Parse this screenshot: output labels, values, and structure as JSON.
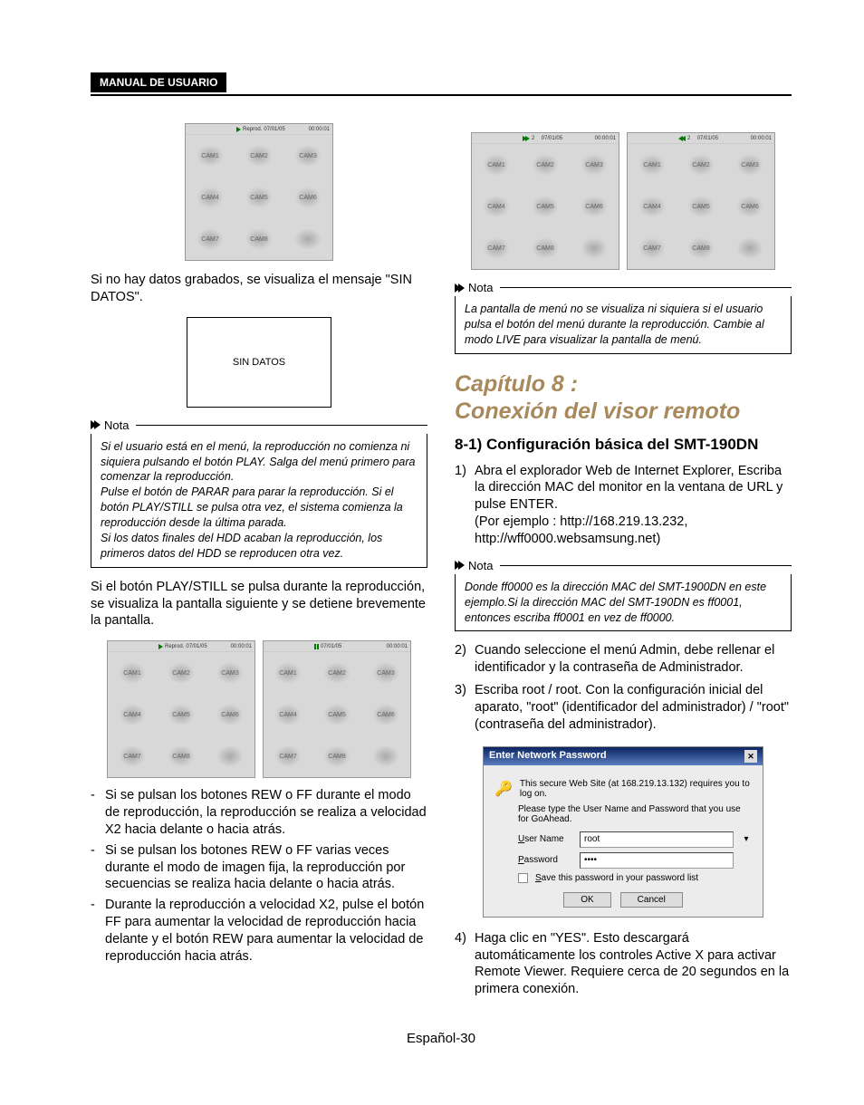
{
  "header": {
    "title": "MANUAL DE USUARIO"
  },
  "cams": [
    "CAM1",
    "CAM2",
    "CAM3",
    "CAM4",
    "CAM5",
    "CAM6",
    "CAM7",
    "CAM8"
  ],
  "grid_bar": {
    "play": {
      "label": "Reprod.",
      "date": "07/01/05",
      "time": "00:00:01"
    },
    "play2": {
      "label": "Reprod.",
      "date": "07/01/05",
      "time": "00:00:01"
    },
    "pause": {
      "date": "07/01/05",
      "time": "00:00:01"
    },
    "ff": {
      "num": "2",
      "date": "07/01/05",
      "time": "00:00:01"
    },
    "rw": {
      "num": "2",
      "date": "07/01/05",
      "time": "00:00:01"
    }
  },
  "left": {
    "p1": "Si no hay datos grabados, se visualiza el mensaje \"SIN DATOS\".",
    "sin_datos": "SIN DATOS",
    "nota_label": "Nota",
    "nota1_l1": "Si el usuario está en el menú, la reproducción no comienza ni siquiera pulsando el botón PLAY. Salga del menú primero para comenzar la reproducción.",
    "nota1_l2": "Pulse el botón de PARAR para parar la reproducción. Si el botón PLAY/STILL se pulsa otra vez, el   sistema comienza la reproducción desde la última parada.",
    "nota1_l3": "Si los datos finales del HDD acaban la reproducción, los primeros datos del HDD se reproducen otra vez.",
    "p2": "Si el botón PLAY/STILL se pulsa durante la reproducción, se visualiza la pantalla siguiente y se detiene brevemente la pantalla.",
    "b1": "Si se pulsan los botones REW o FF durante el modo de reproducción, la reproducción se realiza a velocidad X2 hacia delante o hacia atrás.",
    "b2": "Si se pulsan los botones REW o FF varias veces durante el modo de imagen fija, la reproducción por secuencias se realiza hacia delante o hacia atrás.",
    "b3": "Durante la reproducción a velocidad X2, pulse el botón FF para aumentar la velocidad de reproducción hacia delante y el botón REW para aumentar la velocidad de reproducción hacia atrás."
  },
  "right": {
    "nota_label": "Nota",
    "nota2": "La pantalla de menú no se visualiza ni siquiera si el usuario pulsa el botón del menú durante la reproducción. Cambie al modo LIVE para visualizar la pantalla de menú.",
    "chapter_l1": "Capítulo 8 :",
    "chapter_l2": "Conexión del visor remoto",
    "section": "8-1)   Configuración básica del SMT-190DN",
    "s1": "Abra el explorador Web de Internet Explorer, Escriba la dirección MAC del monitor en la ventana de URL y pulse ENTER.",
    "s1b": "(Por ejemplo : http://168.219.13.232, http://wff0000.websamsung.net)",
    "nota3": "Donde ff0000 es la dirección MAC del SMT-1900DN en este ejemplo.Si la dirección MAC del SMT-190DN es ff0001, entonces escriba ff0001 en vez de ff0000.",
    "s2": "Cuando seleccione el menú Admin, debe rellenar el identificador y la contraseña de Administrador.",
    "s3": "Escriba root / root. Con la configuración inicial del aparato, \"root\" (identificador del administrador) / \"root\" (contraseña del administrador).",
    "s4": "Haga clic en \"YES\". Esto descargará automáticamente los controles Active X para activar Remote Viewer. Requiere cerca de 20 segundos en la primera conexión."
  },
  "dialog": {
    "title": "Enter Network Password",
    "close": "✕",
    "msg1": "This secure Web Site (at 168.219.13.132) requires you to log on.",
    "msg2": "Please type the User Name and Password that you use for GoAhead.",
    "user_label": "User Name",
    "user_val": "root",
    "pass_label": "Password",
    "pass_val": "••••",
    "save": "Save this password in your password list",
    "ok": "OK",
    "cancel": "Cancel",
    "user_first": "U",
    "pass_first": "P",
    "save_first": "S"
  },
  "footer": "Español-30"
}
